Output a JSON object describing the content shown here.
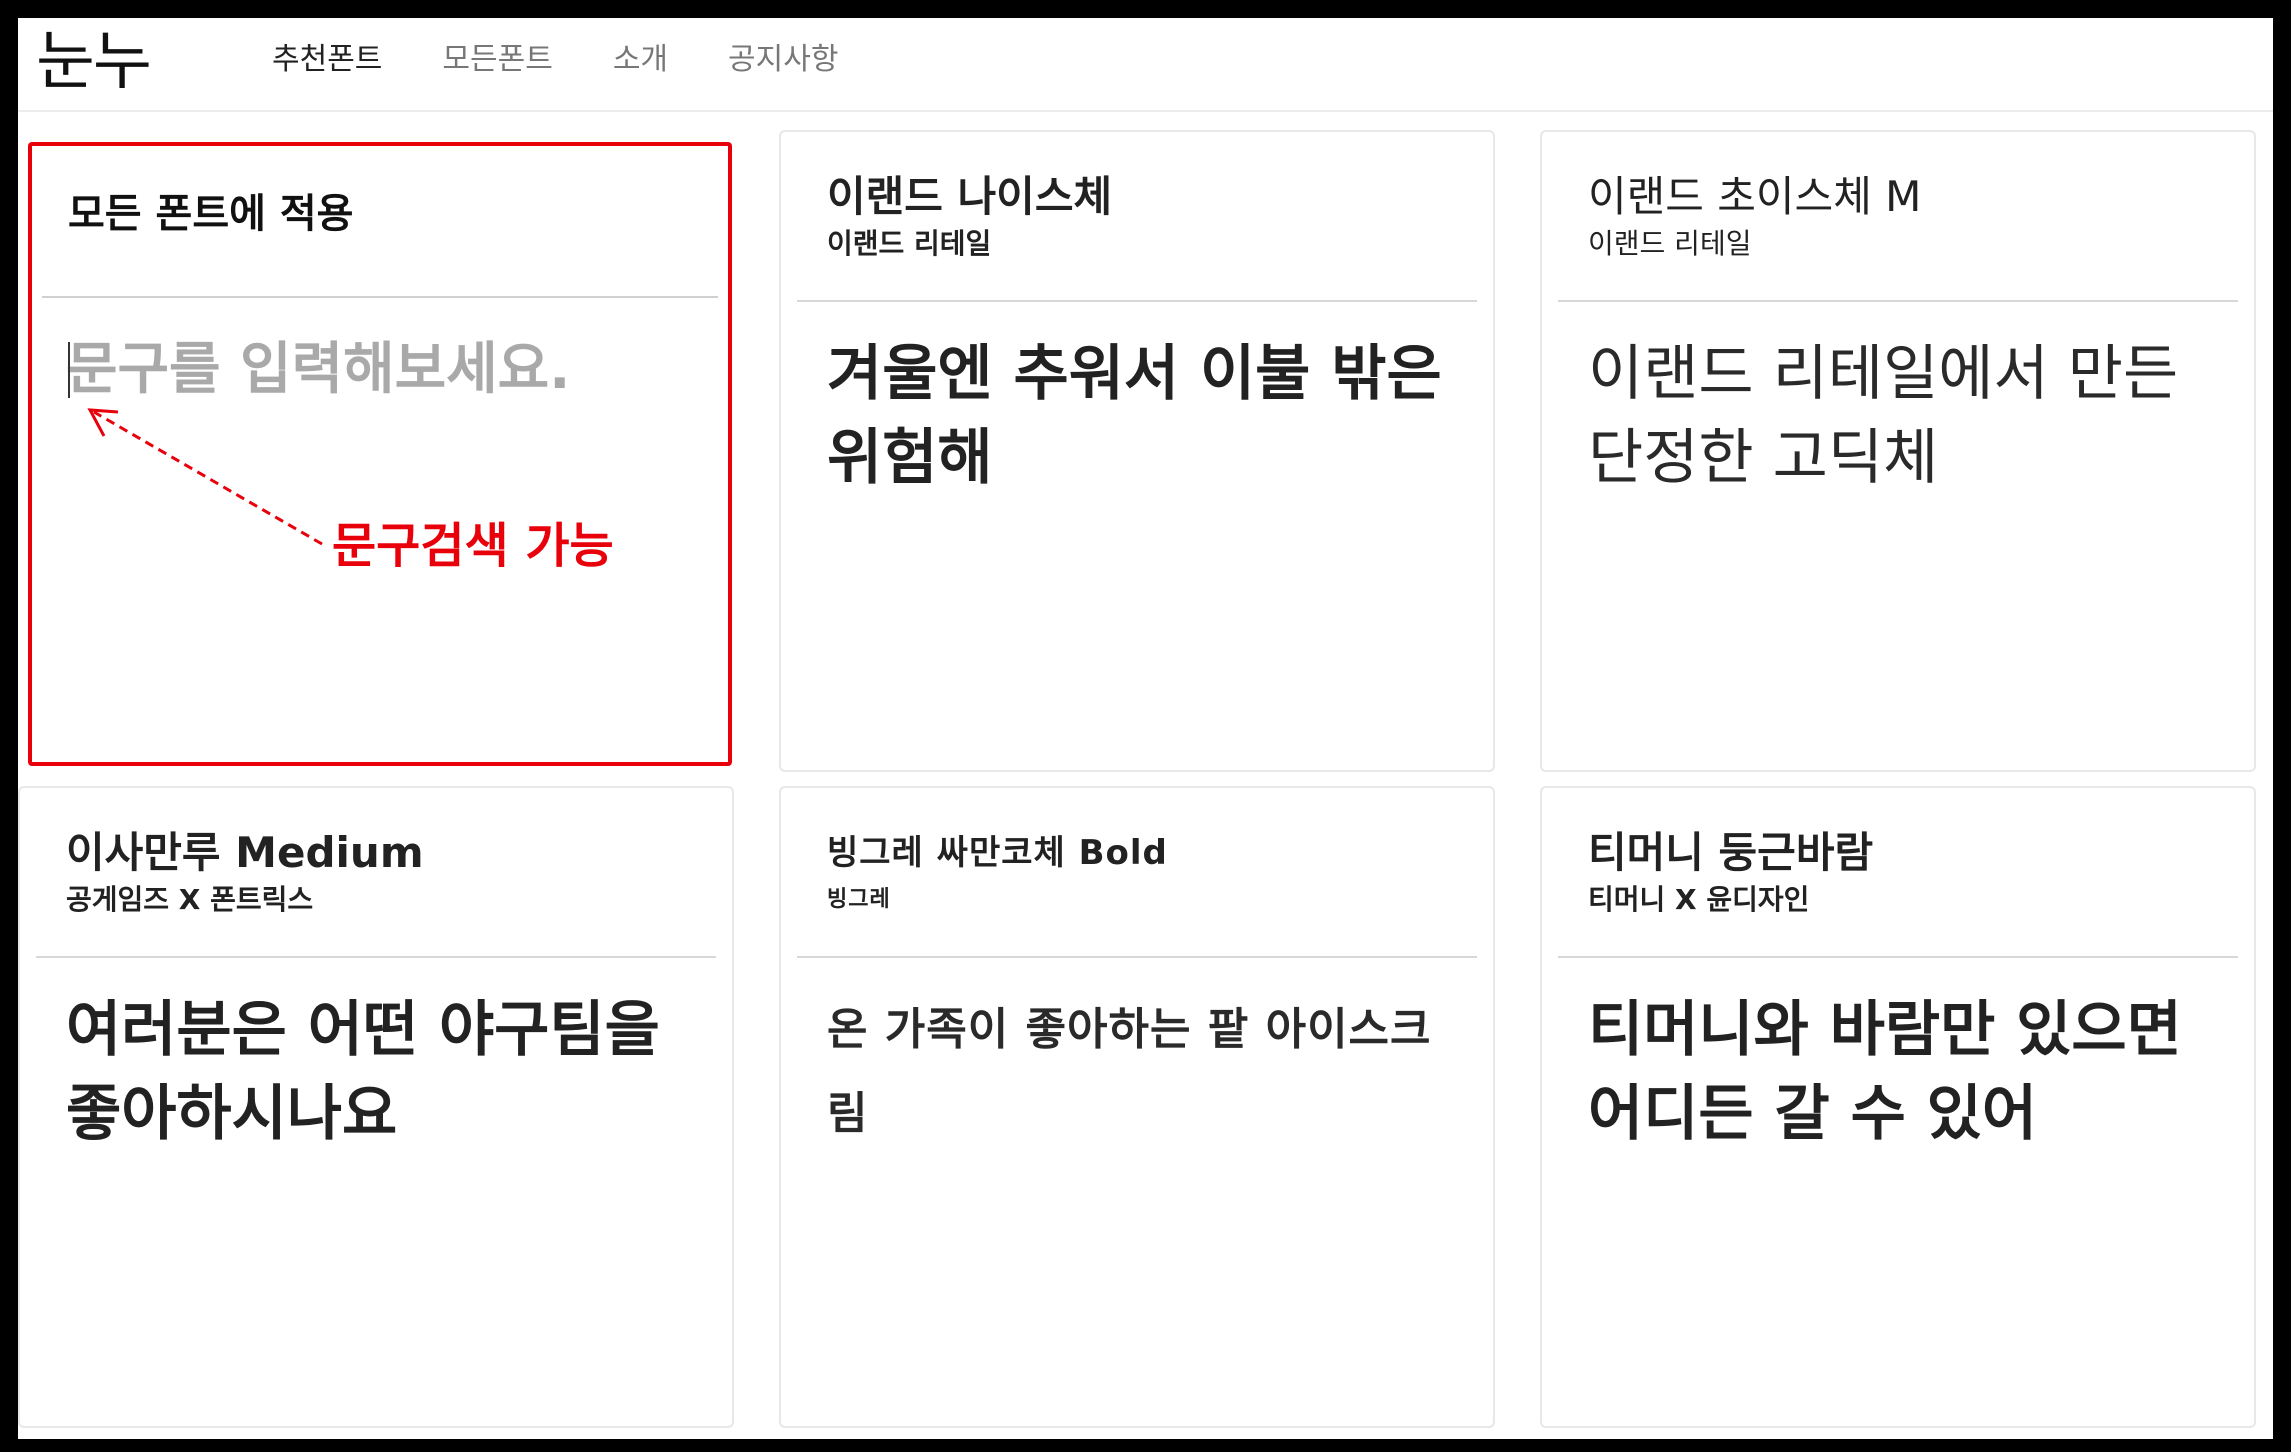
{
  "header": {
    "logo": "눈누",
    "nav": [
      {
        "label": "추천폰트",
        "active": true
      },
      {
        "label": "모든폰트",
        "active": false
      },
      {
        "label": "소개",
        "active": false
      },
      {
        "label": "공지사항",
        "active": false
      }
    ]
  },
  "control": {
    "title": "모든 폰트에 적용",
    "input_placeholder": "문구를 입력해보세요.",
    "input_value": "",
    "annotation": "문구검색 가능"
  },
  "fonts": [
    {
      "name": "이랜드 나이스체",
      "author": "이랜드 리테일",
      "sample": "겨울엔 추워서 이불 밖은 위험해"
    },
    {
      "name": "이랜드 초이스체 M",
      "author": "이랜드 리테일",
      "sample": "이랜드 리테일에서 만든 단정한 고딕체"
    },
    {
      "name": "이사만루 Medium",
      "author": "공게임즈 X 폰트릭스",
      "sample": "여러분은 어떤 야구팀을 좋아하시나요"
    },
    {
      "name": "빙그레 싸만코체 Bold",
      "author": "빙그레",
      "sample": "온 가족이 좋아하는 팥 아이스크림"
    },
    {
      "name": "티머니 둥근바람",
      "author": "티머니 X 윤디자인",
      "sample": "티머니와 바람만 있으면 어디든 갈 수 있어"
    }
  ],
  "colors": {
    "highlight": "#e8000b",
    "text": "#222222",
    "placeholder": "#a9a9a9",
    "border": "#e8e8e8"
  }
}
